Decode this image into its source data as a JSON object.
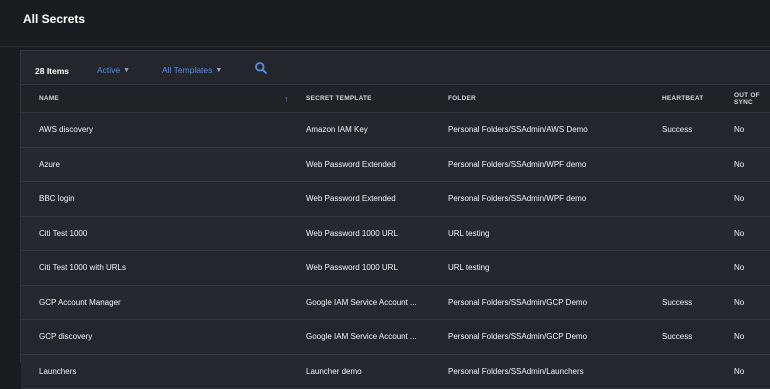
{
  "page": {
    "title": "All Secrets"
  },
  "toolbar": {
    "items_count": "28 Items",
    "status_filter": "Active",
    "template_filter": "All Templates"
  },
  "table": {
    "columns": {
      "name": "NAME",
      "template": "SECRET TEMPLATE",
      "folder": "FOLDER",
      "heartbeat": "HEARTBEAT",
      "out_of_sync": "OUT OF SYNC"
    },
    "rows": [
      {
        "name": "AWS discovery",
        "template": "Amazon IAM Key",
        "folder": "Personal Folders/SSAdmin/AWS Demo",
        "heartbeat": "Success",
        "out_of_sync": "No"
      },
      {
        "name": "Azure",
        "template": "Web Password Extended",
        "folder": "Personal Folders/SSAdmin/WPF demo",
        "heartbeat": "",
        "out_of_sync": "No"
      },
      {
        "name": "BBC login",
        "template": "Web Password Extended",
        "folder": "Personal Folders/SSAdmin/WPF demo",
        "heartbeat": "",
        "out_of_sync": "No"
      },
      {
        "name": "Citi Test 1000",
        "template": "Web Password 1000 URL",
        "folder": "URL testing",
        "heartbeat": "",
        "out_of_sync": "No"
      },
      {
        "name": "Citi Test 1000 with URLs",
        "template": "Web Password 1000 URL",
        "folder": "URL testing",
        "heartbeat": "",
        "out_of_sync": "No"
      },
      {
        "name": "GCP Account Manager",
        "template": "Google IAM Service Account ...",
        "folder": "Personal Folders/SSAdmin/GCP Demo",
        "heartbeat": "Success",
        "out_of_sync": "No"
      },
      {
        "name": "GCP discovery",
        "template": "Google IAM Service Account ...",
        "folder": "Personal Folders/SSAdmin/GCP Demo",
        "heartbeat": "Success",
        "out_of_sync": "No"
      },
      {
        "name": "Launchers",
        "template": "Launcher demo",
        "folder": "Personal Folders/SSAdmin/Launchers",
        "heartbeat": "",
        "out_of_sync": "No"
      }
    ]
  },
  "icons": {
    "search": "search-icon",
    "chevron": "chevron-down-icon",
    "sort": "sort-ascending-icon"
  },
  "colors": {
    "accent": "#4f8fe6",
    "background": "#1b1c20",
    "panel": "#24262b"
  }
}
